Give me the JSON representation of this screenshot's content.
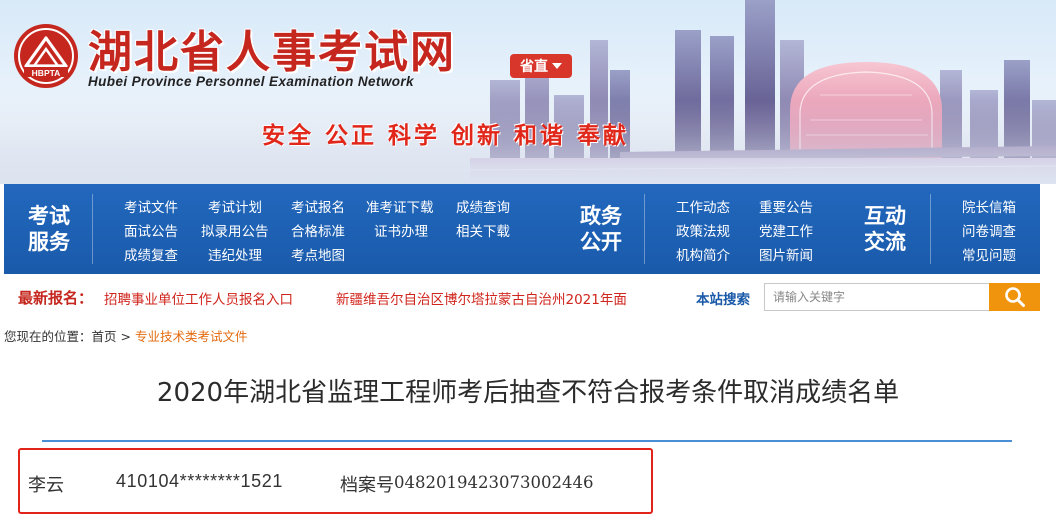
{
  "header": {
    "site_title": "湖北省人事考试网",
    "site_subtitle": "Hubei Province Personnel Examination Network",
    "logo_text": "HBPTA",
    "region_button": "省直",
    "slogan": "安全 公正 科学 创新 和谐 奉献"
  },
  "nav": {
    "groups": [
      {
        "title_line1": "考试",
        "title_line2": "服务",
        "links": [
          "考试文件",
          "考试计划",
          "考试报名",
          "准考证下载",
          "成绩查询",
          "面试公告",
          "拟录用公告",
          "合格标准",
          "证书办理",
          "相关下载",
          "成绩复查",
          "违纪处理",
          "考点地图"
        ]
      },
      {
        "title_line1": "政务",
        "title_line2": "公开",
        "links": [
          "工作动态",
          "重要公告",
          "政策法规",
          "党建工作",
          "机构简介",
          "图片新闻"
        ]
      },
      {
        "title_line1": "互动",
        "title_line2": "交流",
        "links": [
          "院长信箱",
          "问卷调查",
          "常见问题"
        ]
      }
    ]
  },
  "ticker": {
    "label": "最新报名：",
    "items": [
      "招聘事业单位工作人员报名入口",
      "新疆维吾尔自治区博尔塔拉蒙古自治州2021年面"
    ]
  },
  "search": {
    "label": "本站搜索",
    "placeholder": "请输入关键字",
    "icon": "search-icon"
  },
  "breadcrumb": {
    "prefix": "您现在的位置：",
    "home": "首页",
    "separator": ">",
    "current": "专业技术类考试文件"
  },
  "article": {
    "title": "2020年湖北省监理工程师考后抽查不符合报考条件取消成绩名单",
    "record": {
      "name": "李云",
      "id_number": "410104********1521",
      "archive_label": "档案号",
      "archive_number": "0482019423073002446"
    }
  },
  "colors": {
    "brand_red": "#c5271f",
    "nav_blue": "#1f63b6",
    "search_orange": "#f0940e",
    "highlight_box": "#e2231a"
  }
}
